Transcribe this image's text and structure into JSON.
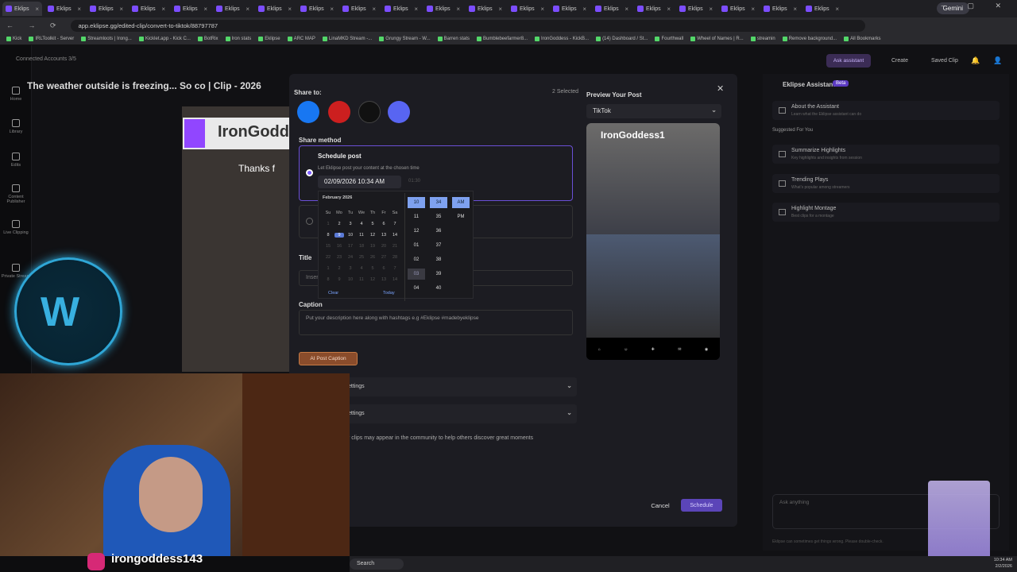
{
  "browser": {
    "tabs": [
      "Eklips",
      "Eklips",
      "Eklips",
      "Eklips",
      "Eklips",
      "Eklips",
      "Eklips",
      "Eklips",
      "Eklips",
      "Eklips",
      "Eklips",
      "Eklips",
      "Eklips",
      "Eklips",
      "Eklips",
      "Eklips",
      "Eklips",
      "Eklips",
      "Eklips",
      "Eklips"
    ],
    "gemini_label": "Gemini",
    "url": "app.eklipse.gg/edited-clip/convert-to-tiktok/88797787",
    "bookmarks": [
      "Kick",
      "IRLToolkit - Server",
      "Streamloots | Irong...",
      "Kicklet.app - Kick C...",
      "BotRix",
      "Iron stats",
      "Eklipse",
      "ARC MAP",
      "LinaMKD Stream -...",
      "Grungy Stream - W...",
      "Barren stats",
      "Bumblebeefarmer8...",
      "IronGoddess - KickB...",
      "(14) Dashboard / St...",
      "Fourthwall",
      "Wheel of Names | R...",
      "streamin",
      "Remove background...",
      "All Bookmarks"
    ]
  },
  "app": {
    "connected_accounts": "Connected Accounts 3/5",
    "clip_title": "The weather outside is freezing... So co | Clip - 2026",
    "nav": [
      {
        "label": "Home",
        "icon": "home-icon"
      },
      {
        "label": "Library",
        "icon": "library-icon"
      },
      {
        "label": "Edits",
        "icon": "scissors-icon"
      },
      {
        "label": "Content Publisher",
        "icon": "calendar-icon"
      },
      {
        "label": "Live Clipping",
        "icon": "live-icon"
      },
      {
        "label": "Private Stream",
        "icon": "private-icon"
      }
    ],
    "topbar": {
      "ask_assistant": "Ask assistant",
      "create": "Create",
      "saved_clip": "Saved Clip"
    }
  },
  "video": {
    "streamer_text": "IronGodd",
    "thanks_text": "Thanks f"
  },
  "assistant": {
    "title": "Eklipse Assistant",
    "beta": "Beta",
    "about": {
      "title": "About the Assistant",
      "sub": "Learn what the Eklipse assistant can do"
    },
    "suggested_header": "Suggested For You",
    "cards": [
      {
        "title": "Summarize Highlights",
        "sub": "Key highlights and insights from session"
      },
      {
        "title": "Trending Plays",
        "sub": "What's popular among streamers"
      },
      {
        "title": "Highlight Montage",
        "sub": "Best clips for a montage"
      }
    ],
    "ask_placeholder": "Ask anything",
    "disclaimer": "Eklipse can sometimes get things wrong. Please double-check."
  },
  "modal": {
    "share_to": "Share to:",
    "selected": "2 Selected",
    "preview_title": "Preview Your Post",
    "platform": "TikTok",
    "phone_caption": "IronGoddess1",
    "share_method": "Share method",
    "schedule_label": "Schedule post",
    "schedule_desc": "Let Eklipse post your content at the chosen time",
    "datetime": "02/09/2026 10:34 AM",
    "timezone": "01:30",
    "title_label": "Title",
    "title_placeholder": "Inser",
    "caption_label": "Caption",
    "caption_placeholder": "Put your description here along with hashtags e.g #Eklipse #madebyeklipse",
    "ai_caption": "AI Post Caption",
    "accordion1": "ettings",
    "accordion2": "ettings",
    "community": "r clips may appear in the community to help others discover great moments",
    "cancel": "Cancel",
    "schedule_btn": "Schedule"
  },
  "calendar": {
    "month": "February 2026",
    "dow": [
      "Su",
      "Mo",
      "Tu",
      "We",
      "Th",
      "Fr",
      "Sa"
    ],
    "weeks": [
      [
        "1",
        "2",
        "3",
        "4",
        "5",
        "6",
        "7"
      ],
      [
        "8",
        "9",
        "10",
        "11",
        "12",
        "13",
        "14"
      ],
      [
        "15",
        "16",
        "17",
        "18",
        "19",
        "20",
        "21"
      ],
      [
        "22",
        "23",
        "24",
        "25",
        "26",
        "27",
        "28"
      ],
      [
        "1",
        "2",
        "3",
        "4",
        "5",
        "6",
        "7"
      ],
      [
        "8",
        "9",
        "10",
        "11",
        "12",
        "13",
        "14"
      ]
    ],
    "clear": "Clear",
    "today": "Today",
    "hours": [
      "10",
      "11",
      "12",
      "01",
      "02",
      "03",
      "04"
    ],
    "minutes": [
      "34",
      "35",
      "36",
      "37",
      "38",
      "39",
      "40"
    ],
    "ampm": [
      "AM",
      "PM"
    ]
  },
  "stream": {
    "handle": "irongoddess143",
    "logo_text": "W"
  },
  "taskbar": {
    "search": "Search",
    "time": "10:34 AM",
    "date": "2/2/2026"
  }
}
